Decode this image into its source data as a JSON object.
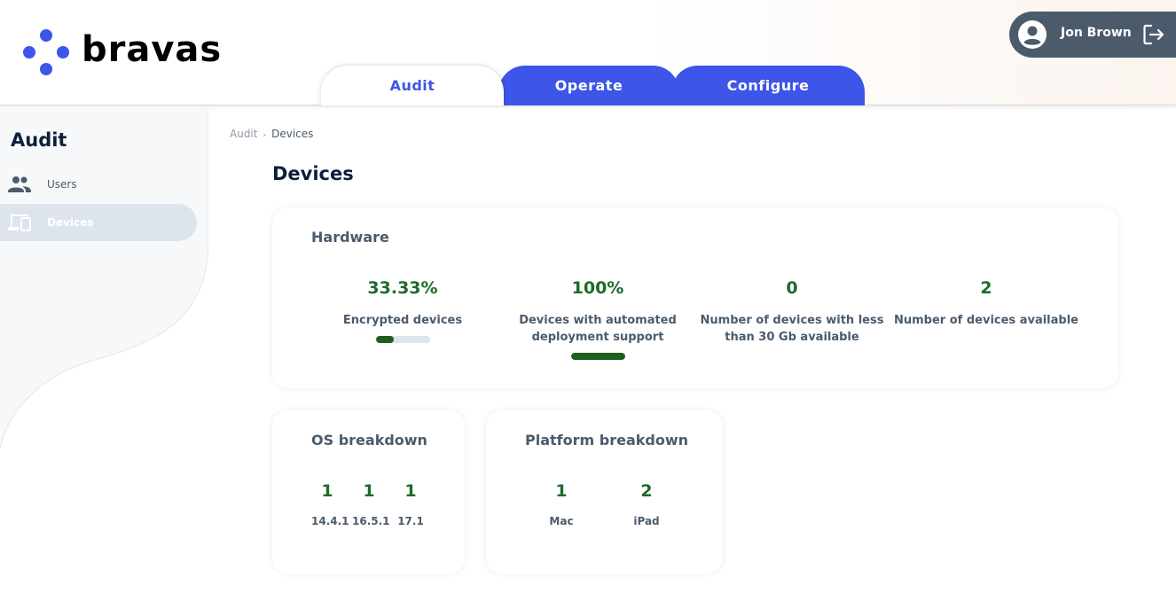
{
  "brand": {
    "name": "bravas",
    "accent": "#3d55e8"
  },
  "tabs": [
    {
      "label": "Audit",
      "active": true
    },
    {
      "label": "Operate",
      "active": false
    },
    {
      "label": "Configure",
      "active": false
    }
  ],
  "user": {
    "name": "Jon Brown",
    "avatar_icon": "account-circle-icon",
    "logout_icon": "logout-icon"
  },
  "sidebar": {
    "title": "Audit",
    "items": [
      {
        "label": "Users",
        "icon": "users-icon",
        "active": false
      },
      {
        "label": "Devices",
        "icon": "devices-icon",
        "active": true
      }
    ]
  },
  "breadcrumb": {
    "root": "Audit",
    "separator": "›",
    "current": "Devices"
  },
  "page": {
    "title": "Devices"
  },
  "hardware": {
    "title": "Hardware",
    "metrics": [
      {
        "value": "33.33%",
        "label": "Encrypted devices",
        "progress": 0.3333
      },
      {
        "value": "100%",
        "label": "Devices with automated deployment support",
        "progress": 1.0
      },
      {
        "value": "0",
        "label": "Number of devices with less than 30 Gb available"
      },
      {
        "value": "2",
        "label": "Number of devices available"
      }
    ]
  },
  "os_breakdown": {
    "title": "OS breakdown",
    "items": [
      {
        "value": "1",
        "label": "14.4.1"
      },
      {
        "value": "1",
        "label": "16.5.1"
      },
      {
        "value": "1",
        "label": "17.1"
      }
    ]
  },
  "platform_breakdown": {
    "title": "Platform breakdown",
    "items": [
      {
        "value": "1",
        "label": "Mac"
      },
      {
        "value": "2",
        "label": "iPad"
      }
    ]
  },
  "colors": {
    "value_green": "#1e6a2b",
    "bar_fill": "#1e5e22",
    "muted_text": "#4b5b6c"
  }
}
